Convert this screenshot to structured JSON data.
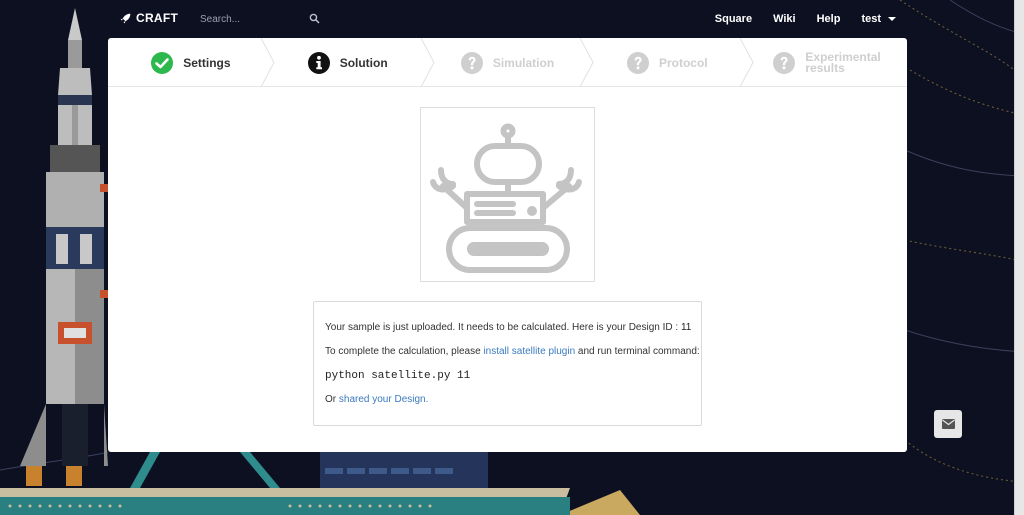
{
  "navbar": {
    "brand": "CRAFT",
    "search_placeholder": "Search...",
    "links": [
      "Square",
      "Wiki",
      "Help"
    ],
    "user": "test"
  },
  "steps": [
    {
      "label": "Settings",
      "state": "done",
      "icon": "check-circle-icon"
    },
    {
      "label": "Solution",
      "state": "active",
      "icon": "info-circle-icon"
    },
    {
      "label": "Simulation",
      "state": "disabled",
      "icon": "question-circle-icon"
    },
    {
      "label": "Protocol",
      "state": "disabled",
      "icon": "question-circle-icon"
    },
    {
      "label_line1": "Experimental",
      "label_line2": "results",
      "state": "disabled",
      "icon": "question-circle-icon"
    }
  ],
  "message": {
    "line1_text": "Your sample is just uploaded. It needs to be calculated. Here is your Design ID : ",
    "design_id": "11",
    "line2_pre": "To complete the calculation, please ",
    "line2_link": "install satellite plugin",
    "line2_post": " and run terminal command:",
    "command": "python satellite.py 11",
    "line4_pre": "Or ",
    "line4_link": "shared your Design."
  },
  "colors": {
    "background": "#0d1021",
    "success": "#2db84d",
    "link": "#3b7bbf",
    "disabled": "#cfcfcf"
  },
  "floating": {
    "icon": "envelope-icon"
  }
}
